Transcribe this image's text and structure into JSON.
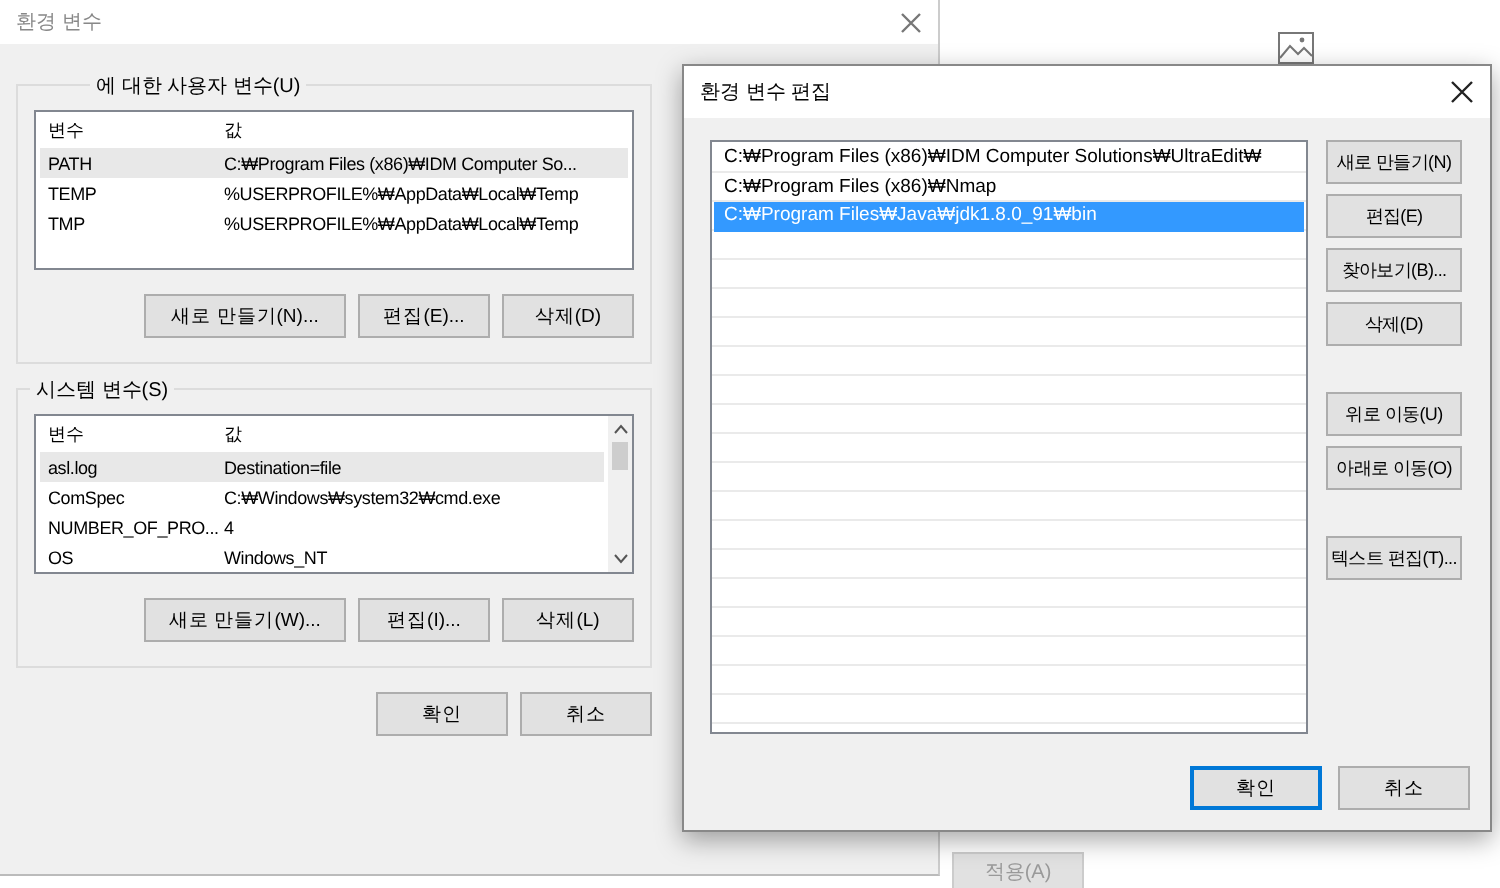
{
  "env_dialog": {
    "title": "환경 변수",
    "user_vars": {
      "label": "에 대한 사용자 변수(U)",
      "columns": [
        "변수",
        "값"
      ],
      "rows": [
        {
          "name": "PATH",
          "value": "C:₩Program Files (x86)₩IDM Computer So...",
          "selected": true
        },
        {
          "name": "TEMP",
          "value": "%USERPROFILE%₩AppData₩Local₩Temp",
          "selected": false
        },
        {
          "name": "TMP",
          "value": "%USERPROFILE%₩AppData₩Local₩Temp",
          "selected": false
        }
      ],
      "buttons": [
        "새로 만들기(N)...",
        "편집(E)...",
        "삭제(D)"
      ]
    },
    "system_vars": {
      "label": "시스템 변수(S)",
      "columns": [
        "변수",
        "값"
      ],
      "rows": [
        {
          "name": "asl.log",
          "value": "Destination=file",
          "selected": true
        },
        {
          "name": "ComSpec",
          "value": "C:₩Windows₩system32₩cmd.exe",
          "selected": false
        },
        {
          "name": "NUMBER_OF_PRO...",
          "value": "4",
          "selected": false
        },
        {
          "name": "OS",
          "value": "Windows_NT",
          "selected": false
        }
      ],
      "buttons": [
        "새로 만들기(W)...",
        "편집(I)...",
        "삭제(L)"
      ]
    },
    "buttons": [
      "확인",
      "취소"
    ]
  },
  "apply_button": {
    "label": "적용(A)",
    "disabled": true
  },
  "edit_dialog": {
    "title": "환경 변수 편집",
    "paths": [
      {
        "text": "C:₩Program Files (x86)₩IDM Computer Solutions₩UltraEdit₩",
        "selected": false
      },
      {
        "text": "C:₩Program Files (x86)₩Nmap",
        "selected": false
      },
      {
        "text": "C:₩Program Files₩Java₩jdk1.8.0_91₩bin",
        "selected": true
      }
    ],
    "side_button_groups": [
      [
        "새로 만들기(N)",
        "편집(E)",
        "찾아보기(B)...",
        "삭제(D)"
      ],
      [
        "위로 이동(U)",
        "아래로 이동(O)"
      ],
      [
        "텍스트 편집(T)..."
      ]
    ],
    "ok": "확인",
    "cancel": "취소"
  }
}
